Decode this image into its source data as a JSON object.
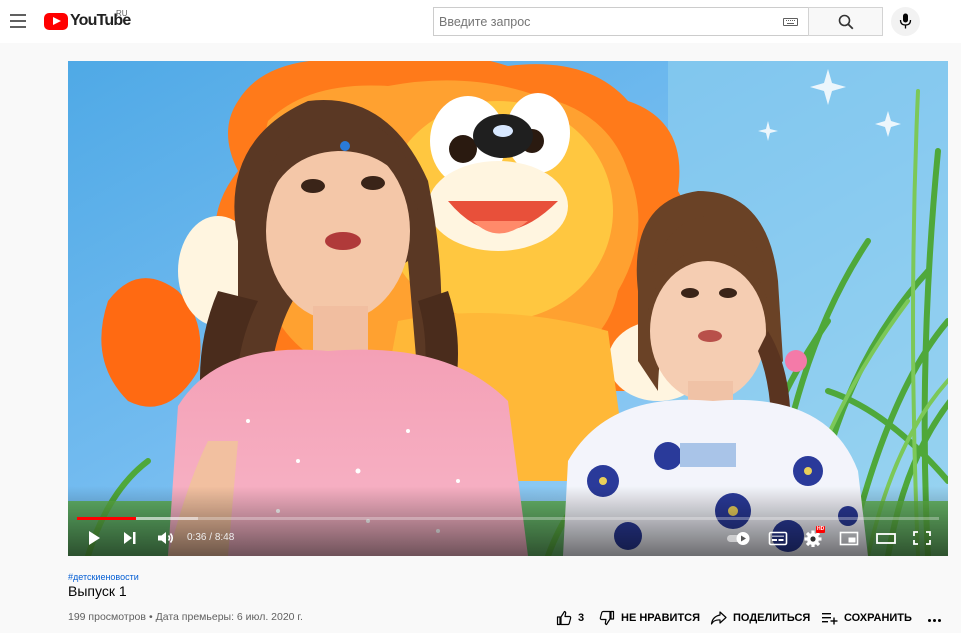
{
  "masthead": {
    "logo_text": "YouTube",
    "region": "RU",
    "search_placeholder": "Введите запрос"
  },
  "player": {
    "current_time": "0:36",
    "time_separator": " / ",
    "duration": "8:48",
    "progress_fraction": 0.068,
    "buffered_fraction": 0.14,
    "settings_badge": "HD"
  },
  "video": {
    "hashtag": "#детскиеновости",
    "title": "Выпуск 1",
    "views": "199 просмотров",
    "separator": "•",
    "premiere": "Дата премьеры: 6 июл. 2020 г."
  },
  "actions": {
    "likes": "3",
    "dislike_label": "НЕ НРАВИТСЯ",
    "share_label": "ПОДЕЛИТЬСЯ",
    "save_label": "СОХРАНИТЬ"
  },
  "colors": {
    "brand_red": "#ff0000",
    "link_blue": "#065fd4",
    "page_bg": "#f9f9f9"
  }
}
